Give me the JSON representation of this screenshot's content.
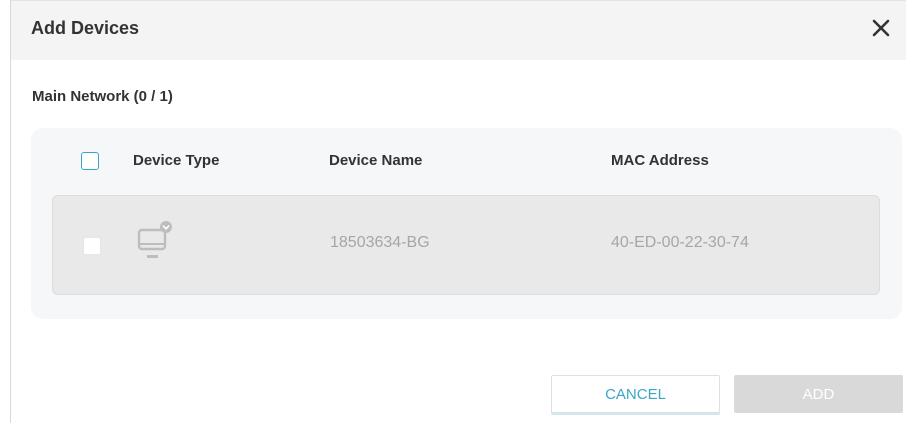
{
  "dialog": {
    "title": "Add Devices",
    "close_icon": "close-icon"
  },
  "section": {
    "title": "Main Network (0 / 1)"
  },
  "table": {
    "columns": [
      "Device Type",
      "Device Name",
      "MAC Address"
    ],
    "rows": [
      {
        "device_type_icon": "computer-icon",
        "device_name": "18503634-BG",
        "mac_address": "40-ED-00-22-30-74",
        "checked": false,
        "disabled": true
      }
    ]
  },
  "buttons": {
    "cancel": "CANCEL",
    "add": "ADD"
  },
  "colors": {
    "accent": "#3aa6c7",
    "disabled_text": "#a6a6a6",
    "disabled_button": "#d9d9d9"
  }
}
